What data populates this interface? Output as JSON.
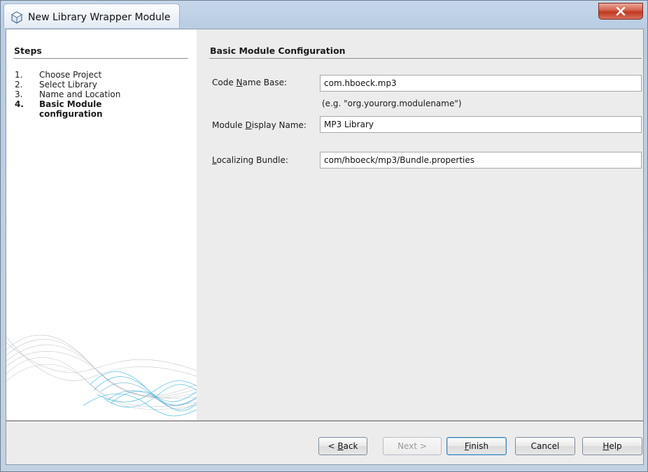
{
  "window": {
    "title": "New Library Wrapper Module",
    "close_label": "x"
  },
  "steps": {
    "heading": "Steps",
    "items": [
      {
        "number": "1.",
        "label": "Choose Project",
        "current": false
      },
      {
        "number": "2.",
        "label": "Select Library",
        "current": false
      },
      {
        "number": "3.",
        "label": "Name and Location",
        "current": false
      },
      {
        "number": "4.",
        "label": "Basic Module configuration",
        "current": true
      }
    ]
  },
  "panel": {
    "heading": "Basic Module Configuration",
    "code_name_base": {
      "label_pre": "Code ",
      "label_mnemonic": "N",
      "label_post": "ame Base:",
      "value": "com.hboeck.mp3"
    },
    "hint": "(e.g. \"org.yourorg.modulename\")",
    "display_name": {
      "label_pre": "Module ",
      "label_mnemonic": "D",
      "label_post": "isplay Name:",
      "value": "MP3 Library"
    },
    "localizing_bundle": {
      "label_pre": "",
      "label_mnemonic": "L",
      "label_post": "ocalizing Bundle:",
      "value": "com/hboeck/mp3/Bundle.properties"
    }
  },
  "buttons": {
    "back": {
      "pre": "< ",
      "mnemonic": "B",
      "post": "ack"
    },
    "next": {
      "label": "Next >"
    },
    "finish": {
      "pre": "",
      "mnemonic": "F",
      "post": "inish"
    },
    "cancel": {
      "label": "Cancel"
    },
    "help": {
      "pre": "",
      "mnemonic": "H",
      "post": "elp"
    }
  },
  "colors": {
    "title_bar": "#c6d7ea",
    "close_button": "#c0391f",
    "wave_accent": "#4fb6d8",
    "default_button_border": "#3c7fb1"
  }
}
